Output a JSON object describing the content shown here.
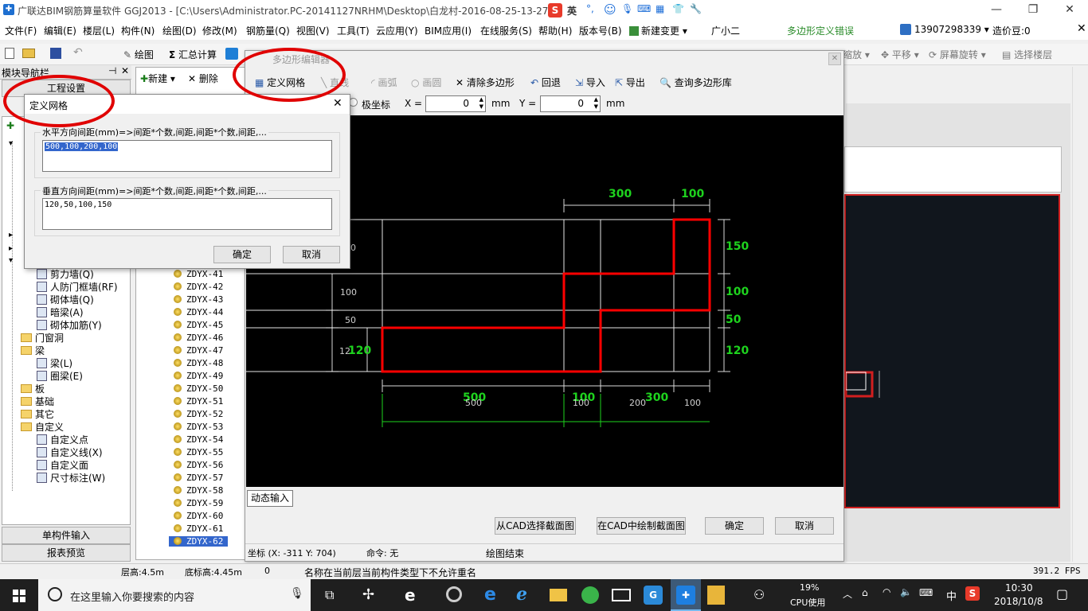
{
  "window": {
    "title": "广联达BIM钢筋算量软件 GGJ2013 - [C:\\Users\\Administrator.PC-20141127NRHM\\Desktop\\白龙村-2016-08-25-13-27",
    "ime_label": "英"
  },
  "menu": {
    "items": [
      "文件(F)",
      "编辑(E)",
      "楼层(L)",
      "构件(N)",
      "绘图(D)",
      "修改(M)",
      "钢筋量(Q)",
      "视图(V)",
      "工具(T)",
      "云应用(Y)",
      "BIM应用(I)",
      "在线服务(S)",
      "帮助(H)",
      "版本号(B)",
      "新建变更",
      "广小二"
    ],
    "error_text": "多边形定义错误",
    "phone": "13907298339",
    "coins": "造价豆:0"
  },
  "toolbar": {
    "draw": "绘图",
    "calc": "汇总计算",
    "zoom": "缩放",
    "pan": "平移",
    "rotate": "屏幕旋转",
    "select_floor": "选择楼层"
  },
  "left_panel": {
    "title": "模块导航栏",
    "project_settings": "工程设置",
    "single_input": "单构件输入",
    "report_preview": "报表预览",
    "tree": [
      {
        "label": "剪力墙(Q)",
        "type": "item",
        "indent": 2
      },
      {
        "label": "人防门框墙(RF)",
        "type": "item",
        "indent": 2
      },
      {
        "label": "砌体墙(Q)",
        "type": "item",
        "indent": 2
      },
      {
        "label": "暗梁(A)",
        "type": "item",
        "indent": 2
      },
      {
        "label": "砌体加筋(Y)",
        "type": "item",
        "indent": 2
      },
      {
        "label": "门窗洞",
        "type": "folder",
        "indent": 1
      },
      {
        "label": "梁",
        "type": "folder",
        "indent": 1
      },
      {
        "label": "梁(L)",
        "type": "item",
        "indent": 2
      },
      {
        "label": "圈梁(E)",
        "type": "item",
        "indent": 2
      },
      {
        "label": "板",
        "type": "folder",
        "indent": 1
      },
      {
        "label": "基础",
        "type": "folder",
        "indent": 1
      },
      {
        "label": "其它",
        "type": "folder",
        "indent": 1
      },
      {
        "label": "自定义",
        "type": "folder",
        "indent": 1
      },
      {
        "label": "自定义点",
        "type": "item",
        "indent": 2
      },
      {
        "label": "自定义线(X)",
        "type": "item",
        "indent": 2
      },
      {
        "label": "自定义面",
        "type": "item",
        "indent": 2
      },
      {
        "label": "尺寸标注(W)",
        "type": "item",
        "indent": 2
      }
    ]
  },
  "component_list": {
    "new": "新建",
    "delete": "删除",
    "items": [
      "ZDYX-41",
      "ZDYX-42",
      "ZDYX-43",
      "ZDYX-44",
      "ZDYX-45",
      "ZDYX-46",
      "ZDYX-47",
      "ZDYX-48",
      "ZDYX-49",
      "ZDYX-50",
      "ZDYX-51",
      "ZDYX-52",
      "ZDYX-53",
      "ZDYX-54",
      "ZDYX-55",
      "ZDYX-56",
      "ZDYX-57",
      "ZDYX-58",
      "ZDYX-59",
      "ZDYX-60",
      "ZDYX-61",
      "ZDYX-62"
    ],
    "selected": "ZDYX-62"
  },
  "editor": {
    "title": "多边形编辑器",
    "define_grid": "定义网格",
    "line": "直线",
    "arc": "画弧",
    "circle": "画圆",
    "clear": "清除多边形",
    "undo": "回退",
    "import": "导入",
    "export": "导出",
    "query": "查询多边形库",
    "polar": "极坐标",
    "x_label": "X =",
    "x_value": "0",
    "y_label": "Y =",
    "y_value": "0",
    "unit": "mm",
    "dynamic_input": "动态输入",
    "from_cad": "从CAD选择截面图",
    "draw_in_cad": "在CAD中绘制截面图",
    "ok": "确定",
    "cancel": "取消",
    "coord": "坐标 (X: -311 Y: 704)",
    "command": "命令: 无",
    "status": "绘图结束"
  },
  "canvas_labels": {
    "green_top": [
      "300",
      "100"
    ],
    "green_right": [
      "150",
      "100",
      "50",
      "120"
    ],
    "green_bottom": [
      "500",
      "100",
      "300"
    ],
    "green_left": "120",
    "white_left": [
      "0",
      "100",
      "50",
      "12"
    ],
    "white_bottom": [
      "500",
      "100",
      "200",
      "100"
    ]
  },
  "grid_dialog": {
    "title": "定义网格",
    "h_label": "水平方向间距(mm)=>间距*个数,间距,间距*个数,间距,...",
    "h_value": "500,100,200,100",
    "v_label": "垂直方向间距(mm)=>间距*个数,间距,间距*个数,间距,...",
    "v_value": "120,50,100,150",
    "ok": "确定",
    "cancel": "取消"
  },
  "statusbar": {
    "floor_height": "层高:4.5m",
    "bottom_height": "底标高:4.45m",
    "count": "0",
    "message": "名称在当前层当前构件类型下不允许重名",
    "fps": "391.2 FPS"
  },
  "taskbar": {
    "search_placeholder": "在这里输入你要搜索的内容",
    "cpu_percent": "19%",
    "cpu_label": "CPU使用",
    "lang": "中",
    "time": "10:30",
    "date": "2018/10/8"
  },
  "colors": {
    "canvas": "#000000",
    "polygon": "#ff0000",
    "green_dim": "#1ed31e",
    "highlight_ellipse": "#e00000",
    "selection": "#3366cc"
  }
}
